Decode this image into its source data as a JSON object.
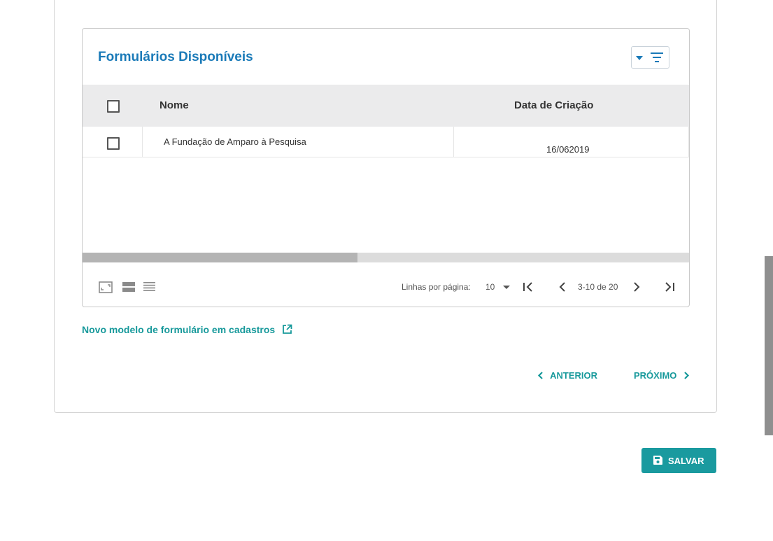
{
  "card": {
    "title": "Formulários Disponíveis",
    "filter_icon": "filter-icon",
    "columns": {
      "name": "Nome",
      "date": "Data de Criação"
    },
    "rows": [
      {
        "name": "A Fundação de Amparo à Pesquisa",
        "date": "16/062019"
      }
    ],
    "footer": {
      "view_icons": [
        "fullscreen-icon",
        "density-comfortable-icon",
        "density-compact-icon"
      ],
      "rows_per_page_label": "Linhas por página:",
      "rows_per_page_value": "10",
      "range": "3-10 de 20"
    }
  },
  "link_new_model": "Novo modelo de formulário em cadastros",
  "nav": {
    "previous": "ANTERIOR",
    "next": "PRÓXIMO"
  },
  "save": {
    "label": "SALVAR",
    "icon": "save-icon"
  },
  "colors": {
    "title": "#1a7ab8",
    "accent": "#17999b",
    "save_bg": "#1a9a9f",
    "header_bg": "#ebebec"
  }
}
